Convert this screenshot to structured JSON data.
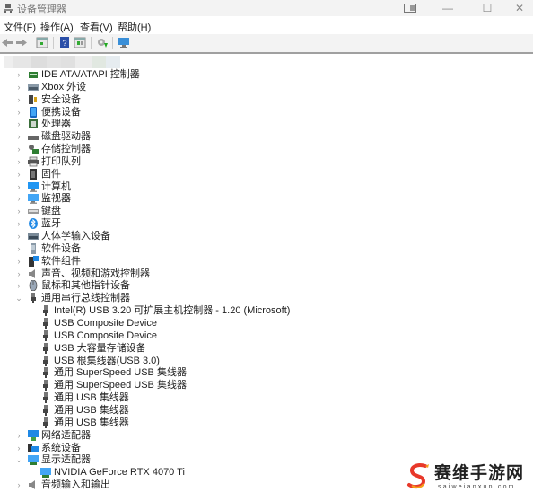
{
  "window": {
    "title": "设备管理器",
    "icons": [
      "device-manager-icon",
      "snap-layout-icon",
      "minimize-icon",
      "maximize-icon",
      "close-icon"
    ]
  },
  "menubar": {
    "items": [
      {
        "label": "文件(F)"
      },
      {
        "label": "操作(A)"
      },
      {
        "label": "查看(V)"
      },
      {
        "label": "帮助(H)"
      }
    ]
  },
  "toolbar": {
    "buttons": [
      "back-icon",
      "forward-icon",
      "properties-icon",
      "help-icon",
      "show-hide-icon",
      "update-driver-icon",
      "scan-hardware-icon"
    ]
  },
  "tree": {
    "categories": [
      {
        "label": "IDE ATA/ATAPI 控制器",
        "icon": "ide-controller-icon",
        "expanded": false
      },
      {
        "label": "Xbox 外设",
        "icon": "xbox-peripheral-icon",
        "expanded": false
      },
      {
        "label": "安全设备",
        "icon": "security-device-icon",
        "expanded": false
      },
      {
        "label": "便携设备",
        "icon": "portable-device-icon",
        "expanded": false
      },
      {
        "label": "处理器",
        "icon": "processor-icon",
        "expanded": false
      },
      {
        "label": "磁盘驱动器",
        "icon": "disk-drive-icon",
        "expanded": false
      },
      {
        "label": "存储控制器",
        "icon": "storage-controller-icon",
        "expanded": false
      },
      {
        "label": "打印队列",
        "icon": "printer-icon",
        "expanded": false
      },
      {
        "label": "固件",
        "icon": "firmware-icon",
        "expanded": false
      },
      {
        "label": "计算机",
        "icon": "computer-icon",
        "expanded": false
      },
      {
        "label": "监视器",
        "icon": "monitor-icon",
        "expanded": false
      },
      {
        "label": "键盘",
        "icon": "keyboard-icon",
        "expanded": false
      },
      {
        "label": "蓝牙",
        "icon": "bluetooth-icon",
        "expanded": false
      },
      {
        "label": "人体学输入设备",
        "icon": "hid-icon",
        "expanded": false
      },
      {
        "label": "软件设备",
        "icon": "software-device-icon",
        "expanded": false
      },
      {
        "label": "软件组件",
        "icon": "software-component-icon",
        "expanded": false
      },
      {
        "label": "声音、视频和游戏控制器",
        "icon": "sound-icon",
        "expanded": false
      },
      {
        "label": "鼠标和其他指针设备",
        "icon": "mouse-icon",
        "expanded": false
      },
      {
        "label": "通用串行总线控制器",
        "icon": "usb-icon",
        "expanded": true,
        "children": [
          "Intel(R) USB 3.20 可扩展主机控制器 - 1.20 (Microsoft)",
          "USB Composite Device",
          "USB Composite Device",
          "USB 大容量存储设备",
          "USB 根集线器(USB 3.0)",
          "通用 SuperSpeed USB 集线器",
          "通用 SuperSpeed USB 集线器",
          "通用 USB 集线器",
          "通用 USB 集线器",
          "通用 USB 集线器"
        ]
      },
      {
        "label": "网络适配器",
        "icon": "network-adapter-icon",
        "expanded": false
      },
      {
        "label": "系统设备",
        "icon": "system-device-icon",
        "expanded": false
      },
      {
        "label": "显示适配器",
        "icon": "display-adapter-icon",
        "expanded": true,
        "children": [
          "NVIDIA GeForce RTX 4070 Ti"
        ]
      },
      {
        "label": "音频输入和输出",
        "icon": "audio-io-icon",
        "expanded": false
      }
    ]
  },
  "watermark": {
    "name": "赛维手游网",
    "url": "saiweianxun.com"
  }
}
